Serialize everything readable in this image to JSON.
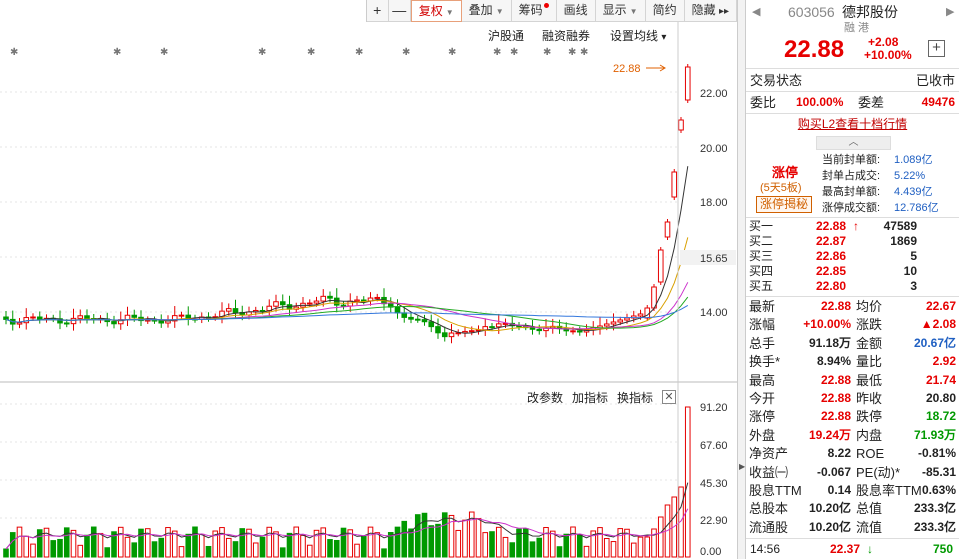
{
  "toolbar": {
    "zoom_in": "+",
    "zoom_out": "—",
    "items": [
      {
        "label": "复权",
        "active": true,
        "caret": true
      },
      {
        "label": "叠加",
        "caret": true
      },
      {
        "label": "筹码",
        "dot": true
      },
      {
        "label": "画线"
      },
      {
        "label": "显示",
        "caret": true
      },
      {
        "label": "简约"
      },
      {
        "label": "隐藏"
      }
    ],
    "more": "▸▸"
  },
  "chart_tools": {
    "hgt": "沪股通",
    "rzrq": "融资融券",
    "ma_settings": "设置均线",
    "caret": "▾"
  },
  "price_axis": [
    "22.00",
    "20.00",
    "18.00",
    "15.65",
    "14.00"
  ],
  "last_price_tag": "22.88",
  "indicator_tools": {
    "params": "改参数",
    "add": "加指标",
    "switch": "换指标",
    "close": "✕"
  },
  "volume_axis": [
    "91.20",
    "67.60",
    "45.30",
    "22.90",
    "0.00"
  ],
  "stock": {
    "code": "603056",
    "name": "德邦股份",
    "badge_rong": "融",
    "badge_gang": "港",
    "price": "22.88",
    "change": "+2.08",
    "change_pct": "+10.00%",
    "add_btn": "+",
    "nav_left": "◀",
    "nav_right": "▶"
  },
  "trade_status": {
    "label": "交易状态",
    "value": "已收市"
  },
  "weibi": {
    "label": "委比",
    "value": "100.00%",
    "label2": "委差",
    "value2": "49476"
  },
  "l2_link": "购买L2查看十档行情",
  "limit_up": {
    "title": "涨停",
    "sub": "(5天5板)",
    "btn": "涨停揭秘",
    "items": [
      {
        "label": "当前封单额:",
        "value": "1.089亿"
      },
      {
        "label": "封单占成交:",
        "value": "5.22%"
      },
      {
        "label": "最高封单额:",
        "value": "4.439亿"
      },
      {
        "label": "涨停成交额:",
        "value": "12.786亿"
      }
    ]
  },
  "bids": [
    {
      "label": "买一",
      "price": "22.88",
      "arrow": "↑",
      "vol": "47589"
    },
    {
      "label": "买二",
      "price": "22.87",
      "vol": "1869"
    },
    {
      "label": "买三",
      "price": "22.86",
      "vol": "5"
    },
    {
      "label": "买四",
      "price": "22.85",
      "vol": "10"
    },
    {
      "label": "买五",
      "price": "22.80",
      "vol": "3"
    }
  ],
  "stats": [
    {
      "l1": "最新",
      "v1": "22.88",
      "c1": "red",
      "l2": "均价",
      "v2": "22.67",
      "c2": "red"
    },
    {
      "l1": "涨幅",
      "v1": "+10.00%",
      "c1": "red",
      "l2": "涨跌",
      "v2": "▲2.08",
      "c2": "red"
    },
    {
      "l1": "总手",
      "v1": "91.18万",
      "c1": "",
      "l2": "金额",
      "v2": "20.67亿",
      "c2": "blue"
    },
    {
      "l1": "换手*",
      "v1": "8.94%",
      "c1": "",
      "l2": "量比",
      "v2": "2.92",
      "c2": "red"
    },
    {
      "l1": "最高",
      "v1": "22.88",
      "c1": "red",
      "l2": "最低",
      "v2": "21.74",
      "c2": "red"
    },
    {
      "l1": "今开",
      "v1": "22.88",
      "c1": "red",
      "l2": "昨收",
      "v2": "20.80",
      "c2": ""
    },
    {
      "l1": "涨停",
      "v1": "22.88",
      "c1": "red",
      "l2": "跌停",
      "v2": "18.72",
      "c2": "green"
    },
    {
      "l1": "外盘",
      "v1": "19.24万",
      "c1": "red",
      "l2": "内盘",
      "v2": "71.93万",
      "c2": "green"
    },
    {
      "l1": "净资产",
      "v1": "8.22",
      "c1": "",
      "l2": "ROE",
      "v2": "-0.81%",
      "c2": ""
    },
    {
      "l1": "收益㈠",
      "v1": "-0.067",
      "c1": "",
      "l2": "PE(动)*",
      "v2": "-85.31",
      "c2": ""
    },
    {
      "l1": "股息TTM",
      "v1": "0.14",
      "c1": "",
      "l2": "股息率TTM",
      "v2": "0.63%",
      "c2": ""
    },
    {
      "l1": "总股本",
      "v1": "10.20亿",
      "c1": "",
      "l2": "总值",
      "v2": "233.3亿",
      "c2": ""
    },
    {
      "l1": "流通股",
      "v1": "10.20亿",
      "c1": "",
      "l2": "流值",
      "v2": "233.3亿",
      "c2": ""
    }
  ],
  "last_tick": {
    "time": "14:56",
    "price": "22.37",
    "arrow": "↓",
    "vol": "750"
  },
  "colors": {
    "up": "#e60000",
    "down": "#009900",
    "link": "#1f5fc2"
  }
}
